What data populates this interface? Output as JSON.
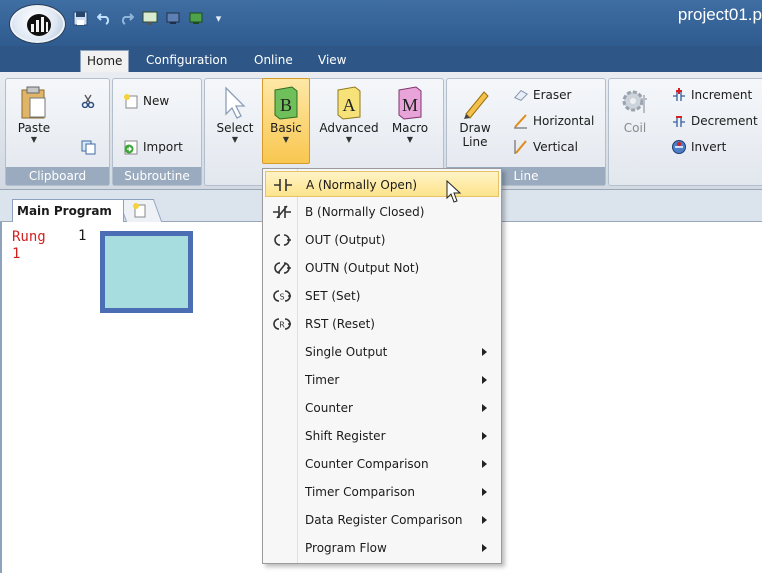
{
  "window": {
    "title": "project01.p"
  },
  "tabs": [
    {
      "label": "Home"
    },
    {
      "label": "Configuration"
    },
    {
      "label": "Online"
    },
    {
      "label": "View"
    }
  ],
  "ribbon": {
    "clipboard": {
      "label": "Clipboard",
      "paste": "Paste"
    },
    "subroutine": {
      "label": "Subroutine",
      "new": "New",
      "import": "Import"
    },
    "instructions": {
      "select": "Select",
      "basic": "Basic",
      "advanced": "Advanced",
      "macro": "Macro",
      "basic_icon_letter": "B",
      "advanced_icon_letter": "A",
      "macro_icon_letter": "M"
    },
    "line": {
      "label": "Line",
      "draw_line_1": "Draw",
      "draw_line_2": "Line",
      "eraser": "Eraser",
      "horizontal": "Horizontal",
      "vertical": "Vertical"
    },
    "coil": {
      "coil": "Coil",
      "increment": "Increment",
      "decrement": "Decrement",
      "invert": "Invert"
    }
  },
  "document": {
    "tab": "Main Program"
  },
  "editor": {
    "rung_label": "Rung",
    "rung_number": "1",
    "rung_index": "1"
  },
  "menu": {
    "items": [
      {
        "label": "A (Normally Open)",
        "icon": "normally-open-contact-icon",
        "submenu": false
      },
      {
        "label": "B (Normally Closed)",
        "icon": "normally-closed-contact-icon",
        "submenu": false
      },
      {
        "label": "OUT (Output)",
        "icon": "output-coil-icon",
        "submenu": false
      },
      {
        "label": "OUTN (Output Not)",
        "icon": "output-not-coil-icon",
        "submenu": false
      },
      {
        "label": "SET (Set)",
        "icon": "set-coil-icon",
        "submenu": false
      },
      {
        "label": "RST (Reset)",
        "icon": "reset-coil-icon",
        "submenu": false
      },
      {
        "label": "Single Output",
        "submenu": true
      },
      {
        "label": "Timer",
        "submenu": true
      },
      {
        "label": "Counter",
        "submenu": true
      },
      {
        "label": "Shift Register",
        "submenu": true
      },
      {
        "label": "Counter Comparison",
        "submenu": true
      },
      {
        "label": "Timer Comparison",
        "submenu": true
      },
      {
        "label": "Data Register Comparison",
        "submenu": true
      },
      {
        "label": "Program Flow",
        "submenu": true
      }
    ]
  },
  "colors": {
    "titlebar": "#3f6ea3",
    "rung_text": "#d21f1f",
    "cell_fill": "#a8dde0",
    "cell_border": "#4a6db4",
    "menu_highlight": "#fde48b"
  }
}
